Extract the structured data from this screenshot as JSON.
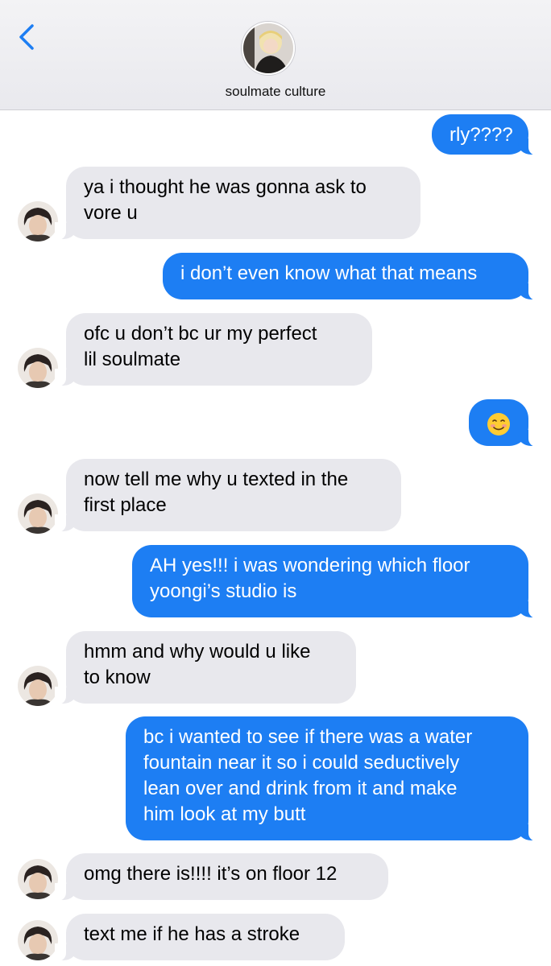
{
  "header": {
    "contact_name": "soulmate culture",
    "back_icon": "chevron-left-icon",
    "avatar_icon": "contact-photo"
  },
  "colors": {
    "outgoing_bubble": "#1d7ef3",
    "incoming_bubble": "#e8e8ed",
    "header_bg": "#eeeef2",
    "accent": "#1d7ef3"
  },
  "messages": [
    {
      "dir": "out",
      "lines": [
        "rly????"
      ]
    },
    {
      "dir": "in",
      "lines": [
        "ya i thought he was gonna ask to",
        "vore u"
      ]
    },
    {
      "dir": "out",
      "lines": [
        "i don’t even know what that means"
      ]
    },
    {
      "dir": "in",
      "lines": [
        "ofc u don’t bc ur my perfect",
        "lil soulmate"
      ]
    },
    {
      "dir": "out",
      "lines": [
        "☺️"
      ],
      "emoji": "smiling-face-emoji"
    },
    {
      "dir": "in",
      "lines": [
        "now tell me why u texted in the",
        "first place"
      ]
    },
    {
      "dir": "out",
      "lines": [
        "AH yes!!! i was wondering which floor",
        "yoongi’s studio is"
      ]
    },
    {
      "dir": "in",
      "lines": [
        "hmm and why would u like",
        "to know"
      ]
    },
    {
      "dir": "out",
      "lines": [
        "bc i wanted to see if there was a water",
        "fountain near it so i could seductively",
        "lean over and drink from it and make",
        "him look at my butt"
      ]
    },
    {
      "dir": "in",
      "lines": [
        "omg there is!!!! it’s on floor 12"
      ]
    },
    {
      "dir": "in",
      "lines": [
        "text me if he has a stroke"
      ]
    }
  ]
}
